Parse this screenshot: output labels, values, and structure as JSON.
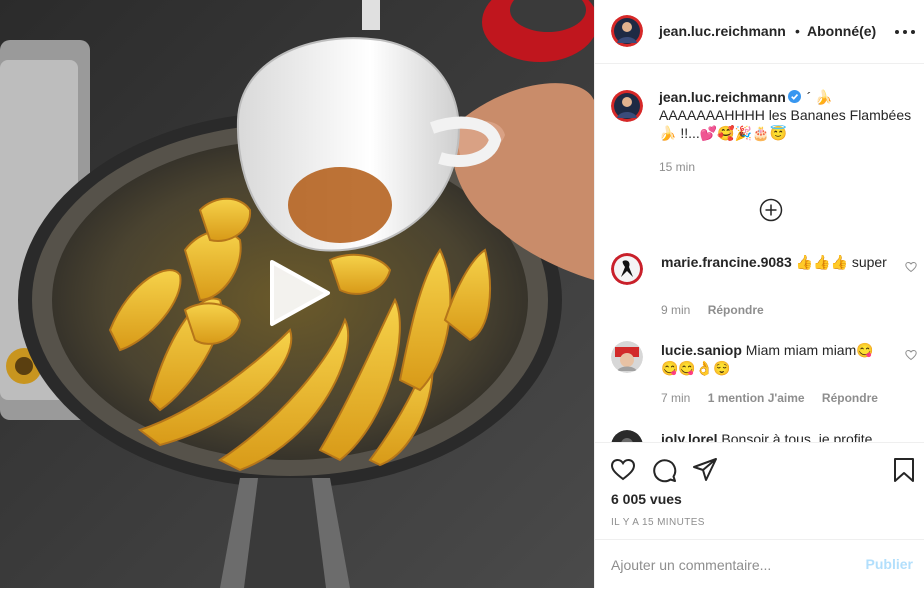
{
  "colors": {
    "text": "#262626",
    "muted": "#8e8e8e",
    "border": "#efefef",
    "link_disabled": "#b2dffc",
    "verified": "#3897f0"
  },
  "media": {
    "type": "video",
    "play_icon": "play-icon"
  },
  "header": {
    "username": "jean.luc.reichmann",
    "separator": "•",
    "follow_status": "Abonné(e)",
    "more_icon": "more-options-icon"
  },
  "caption": {
    "username": "jean.luc.reichmann",
    "text": " ´ 🍌 AAAAAAAHHHH les Bananes Flambées 🍌 !!...💕🥰🎉🎂😇",
    "time": "15 min"
  },
  "load_more_icon": "plus-circle-icon",
  "comments": [
    {
      "username": "marie.francine.9083",
      "text": " 👍👍👍 super",
      "time": "9 min",
      "likes": "",
      "reply": "Répondre"
    },
    {
      "username": "lucie.saniop",
      "text": " Miam miam miam😋😋😋👌😌",
      "time": "7 min",
      "likes": "1 mention J'aime",
      "reply": "Répondre"
    },
    {
      "username": "joly.lorel",
      "text": " Bonsoir à tous, je profite"
    }
  ],
  "actions": {
    "icons": [
      "heart-icon",
      "comment-icon",
      "share-icon",
      "bookmark-icon"
    ],
    "views": "6 005 vues",
    "timestamp": "IL Y A 15 MINUTES"
  },
  "comment_form": {
    "placeholder": "Ajouter un commentaire...",
    "publish_label": "Publier"
  }
}
